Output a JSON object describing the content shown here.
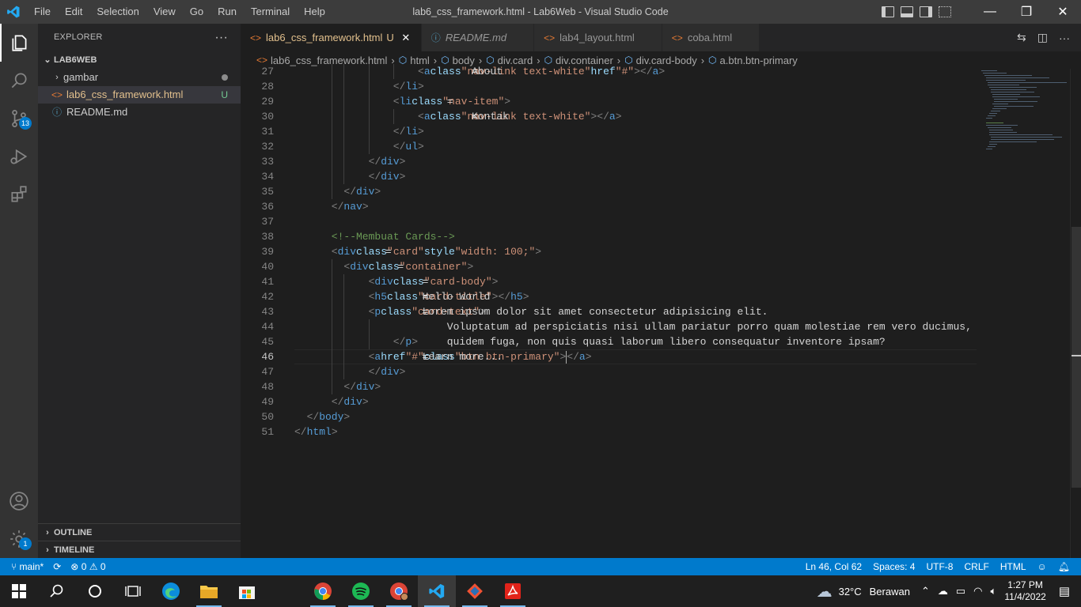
{
  "titlebar": {
    "menu": [
      "File",
      "Edit",
      "Selection",
      "View",
      "Go",
      "Run",
      "Terminal",
      "Help"
    ],
    "window_title": "lab6_css_framework.html - Lab6Web - Visual Studio Code",
    "icons": [
      "vscode-logo-icon",
      "toggle-sidebar-icon",
      "toggle-panel-icon",
      "toggle-secondary-sidebar-icon",
      "customize-layout-icon",
      "minimize-icon",
      "restore-icon",
      "close-icon"
    ],
    "controls": {
      "minimize": "—",
      "restore": "❐",
      "close": "✕"
    }
  },
  "activity_bar": {
    "items": [
      "explorer",
      "search",
      "source-control",
      "run-and-debug",
      "extensions"
    ],
    "source_control_badge": "13",
    "manage_badge": "1"
  },
  "explorer": {
    "title": "EXPLORER",
    "more": "···",
    "workspace": "LAB6WEB",
    "items": [
      {
        "label": "gambar",
        "type": "folder",
        "decoration": "dot"
      },
      {
        "label": "lab6_css_framework.html",
        "type": "html",
        "decoration": "U",
        "selected": true
      },
      {
        "label": "README.md",
        "type": "info",
        "decoration": ""
      }
    ],
    "outline": "OUTLINE",
    "timeline": "TIMELINE"
  },
  "tabs": [
    {
      "label": "lab6_css_framework.html",
      "status": "U",
      "active": true,
      "icon": "html-icon"
    },
    {
      "label": "README.md",
      "status": "",
      "active": false,
      "italic": true,
      "icon": "info-icon"
    },
    {
      "label": "lab4_layout.html",
      "status": "",
      "active": false,
      "icon": "html-icon"
    },
    {
      "label": "coba.html",
      "status": "",
      "active": false,
      "icon": "html-icon"
    }
  ],
  "breadcrumbs": [
    "lab6_css_framework.html",
    "html",
    "body",
    "div.card",
    "div.container",
    "div.card-body",
    "a.btn.btn-primary"
  ],
  "code": {
    "current_line": "46",
    "lines": [
      {
        "n": "27",
        "indent": 20,
        "segments": [
          [
            "brk",
            "<"
          ],
          [
            "tag",
            "a"
          ],
          [
            "txt",
            " "
          ],
          [
            "attr",
            "class"
          ],
          [
            "txt",
            "="
          ],
          [
            "str",
            "\"nav-link text-white\""
          ],
          [
            "txt",
            " "
          ],
          [
            "attr",
            "href"
          ],
          [
            "txt",
            "="
          ],
          [
            "str",
            "\"#\""
          ],
          [
            "brk",
            ">"
          ],
          [
            "txt",
            "About"
          ],
          [
            "brk",
            "</"
          ],
          [
            "tag",
            "a"
          ],
          [
            "brk",
            ">"
          ]
        ]
      },
      {
        "n": "28",
        "indent": 16,
        "segments": [
          [
            "brk",
            "</"
          ],
          [
            "tag",
            "li"
          ],
          [
            "brk",
            ">"
          ]
        ]
      },
      {
        "n": "29",
        "indent": 16,
        "segments": [
          [
            "brk",
            "<"
          ],
          [
            "tag",
            "li"
          ],
          [
            "txt",
            " "
          ],
          [
            "attr",
            "class"
          ],
          [
            "txt",
            "="
          ],
          [
            "str",
            "\"nav-item\""
          ],
          [
            "brk",
            ">"
          ]
        ]
      },
      {
        "n": "30",
        "indent": 20,
        "segments": [
          [
            "brk",
            "<"
          ],
          [
            "tag",
            "a"
          ],
          [
            "txt",
            " "
          ],
          [
            "attr",
            "class"
          ],
          [
            "txt",
            "="
          ],
          [
            "str",
            "\"nav-link text-white\""
          ],
          [
            "brk",
            ">"
          ],
          [
            "txt",
            "Kontak"
          ],
          [
            "brk",
            "</"
          ],
          [
            "tag",
            "a"
          ],
          [
            "brk",
            ">"
          ]
        ]
      },
      {
        "n": "31",
        "indent": 16,
        "segments": [
          [
            "brk",
            "</"
          ],
          [
            "tag",
            "li"
          ],
          [
            "brk",
            ">"
          ]
        ]
      },
      {
        "n": "32",
        "indent": 16,
        "segments": [
          [
            "brk",
            "</"
          ],
          [
            "tag",
            "ul"
          ],
          [
            "brk",
            ">"
          ]
        ]
      },
      {
        "n": "33",
        "indent": 12,
        "segments": [
          [
            "brk",
            "</"
          ],
          [
            "tag",
            "div"
          ],
          [
            "brk",
            ">"
          ]
        ]
      },
      {
        "n": "34",
        "indent": 12,
        "segments": [
          [
            "brk",
            "</"
          ],
          [
            "tag",
            "div"
          ],
          [
            "brk",
            ">"
          ]
        ]
      },
      {
        "n": "35",
        "indent": 8,
        "segments": [
          [
            "brk",
            "</"
          ],
          [
            "tag",
            "div"
          ],
          [
            "brk",
            ">"
          ]
        ]
      },
      {
        "n": "36",
        "indent": 6,
        "segments": [
          [
            "brk",
            "</"
          ],
          [
            "tag",
            "nav"
          ],
          [
            "brk",
            ">"
          ]
        ]
      },
      {
        "n": "37",
        "indent": 0,
        "segments": []
      },
      {
        "n": "38",
        "indent": 6,
        "segments": [
          [
            "cmt",
            "<!--Membuat Cards-->"
          ]
        ]
      },
      {
        "n": "39",
        "indent": 6,
        "segments": [
          [
            "brk",
            "<"
          ],
          [
            "tag",
            "div"
          ],
          [
            "txt",
            " "
          ],
          [
            "attr",
            "class"
          ],
          [
            "txt",
            "="
          ],
          [
            "str",
            "\"card\""
          ],
          [
            "txt",
            " "
          ],
          [
            "attr",
            "style"
          ],
          [
            "txt",
            "="
          ],
          [
            "str",
            "\"width: 100;\""
          ],
          [
            "brk",
            ">"
          ]
        ]
      },
      {
        "n": "40",
        "indent": 8,
        "segments": [
          [
            "brk",
            "<"
          ],
          [
            "tag",
            "div"
          ],
          [
            "txt",
            " "
          ],
          [
            "attr",
            "class"
          ],
          [
            "txt",
            "="
          ],
          [
            "str",
            "\"container\""
          ],
          [
            "brk",
            ">"
          ]
        ]
      },
      {
        "n": "41",
        "indent": 12,
        "segments": [
          [
            "brk",
            "<"
          ],
          [
            "tag",
            "div"
          ],
          [
            "txt",
            " "
          ],
          [
            "attr",
            "class"
          ],
          [
            "txt",
            "="
          ],
          [
            "str",
            "\"card-body\""
          ],
          [
            "brk",
            ">"
          ]
        ]
      },
      {
        "n": "42",
        "indent": 12,
        "segments": [
          [
            "brk",
            "<"
          ],
          [
            "tag",
            "h5"
          ],
          [
            "txt",
            " "
          ],
          [
            "attr",
            "class"
          ],
          [
            "txt",
            "="
          ],
          [
            "str",
            "\"card-title\""
          ],
          [
            "brk",
            ">"
          ],
          [
            "txt",
            "Hello World"
          ],
          [
            "brk",
            "</"
          ],
          [
            "tag",
            "h5"
          ],
          [
            "brk",
            ">"
          ]
        ]
      },
      {
        "n": "43",
        "indent": 12,
        "segments": [
          [
            "brk",
            "<"
          ],
          [
            "tag",
            "p"
          ],
          [
            "txt",
            " "
          ],
          [
            "attr",
            "class"
          ],
          [
            "txt",
            "="
          ],
          [
            "str",
            "\"card-text\""
          ],
          [
            "brk",
            ">"
          ],
          [
            "txt",
            "Lorem ipsum dolor sit amet consectetur adipisicing elit."
          ]
        ]
      },
      {
        "n": "44",
        "indent": 16,
        "segments": [
          [
            "txt",
            "Voluptatum ad perspiciatis nisi ullam pariatur porro quam molestiae rem vero ducimus,"
          ]
        ]
      },
      {
        "n": "45",
        "indent": 16,
        "segments": [
          [
            "txt",
            "quidem fuga, non quis quasi laborum libero consequatur inventore ipsam?"
          ],
          [
            "brk",
            "</"
          ],
          [
            "tag",
            "p"
          ],
          [
            "brk",
            ">"
          ]
        ]
      },
      {
        "n": "46",
        "indent": 12,
        "segments": [
          [
            "brk",
            "<"
          ],
          [
            "tag",
            "a"
          ],
          [
            "txt",
            " "
          ],
          [
            "attr",
            "href"
          ],
          [
            "txt",
            "="
          ],
          [
            "str",
            "\"#\""
          ],
          [
            "txt",
            " "
          ],
          [
            "attr",
            "class"
          ],
          [
            "txt",
            "="
          ],
          [
            "str",
            "\"btn btn-primary\""
          ],
          [
            "brk",
            ">"
          ],
          [
            "txt",
            "Learn more..."
          ],
          [
            "cursor",
            ""
          ],
          [
            "brk",
            "</"
          ],
          [
            "tag",
            "a"
          ],
          [
            "brk",
            ">"
          ]
        ]
      },
      {
        "n": "47",
        "indent": 12,
        "segments": [
          [
            "brk",
            "</"
          ],
          [
            "tag",
            "div"
          ],
          [
            "brk",
            ">"
          ]
        ]
      },
      {
        "n": "48",
        "indent": 8,
        "segments": [
          [
            "brk",
            "</"
          ],
          [
            "tag",
            "div"
          ],
          [
            "brk",
            ">"
          ]
        ]
      },
      {
        "n": "49",
        "indent": 6,
        "segments": [
          [
            "brk",
            "</"
          ],
          [
            "tag",
            "div"
          ],
          [
            "brk",
            ">"
          ]
        ]
      },
      {
        "n": "50",
        "indent": 2,
        "segments": [
          [
            "brk",
            "</"
          ],
          [
            "tag",
            "body"
          ],
          [
            "brk",
            ">"
          ]
        ]
      },
      {
        "n": "51",
        "indent": 0,
        "segments": [
          [
            "brk",
            "</"
          ],
          [
            "tag",
            "html"
          ],
          [
            "brk",
            ">"
          ]
        ]
      }
    ]
  },
  "statusbar": {
    "branch": "main*",
    "errors": "0",
    "warnings": "0",
    "position": "Ln 46, Col 62",
    "spaces": "Spaces: 4",
    "encoding": "UTF-8",
    "eol": "CRLF",
    "language": "HTML"
  },
  "taskbar": {
    "apps": [
      "start-icon",
      "search-icon",
      "cortana-icon",
      "task-view-icon",
      "edge-icon",
      "file-explorer-icon",
      "store-icon",
      "chrome-icon",
      "spotify-icon",
      "chrome-profile-icon",
      "vscode-icon",
      "git-icon",
      "acrobat-icon"
    ],
    "weather_temp": "32°C",
    "weather_desc": "Berawan",
    "time": "1:27 PM",
    "date": "11/4/2022"
  },
  "colors": {
    "statusbar": "#007acc",
    "tag": "#569cd6",
    "attr": "#9cdcfe",
    "string": "#ce9178",
    "comment": "#6a9955"
  }
}
